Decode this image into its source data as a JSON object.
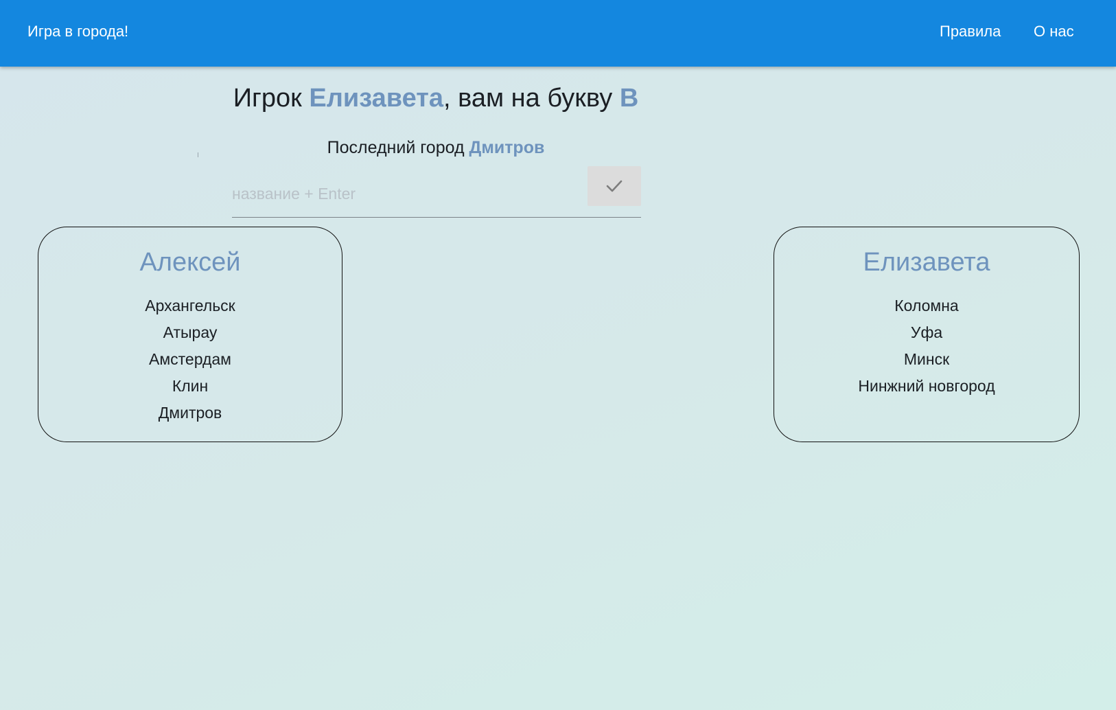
{
  "header": {
    "brand": "Игра в города!",
    "nav": [
      {
        "label": "Правила"
      },
      {
        "label": "О нас"
      }
    ]
  },
  "game": {
    "prompt_prefix": "Игрок ",
    "current_player": "Елизавета",
    "prompt_middle": ", вам на букву ",
    "letter": "В",
    "last_city_label": "Последний город ",
    "last_city": "Дмитров",
    "input_placeholder": "название + Enter",
    "input_value": "",
    "submit_icon": "check-icon"
  },
  "players": [
    {
      "name": "Алексей",
      "cities": [
        "Архангельск",
        "Атырау",
        "Амстердам",
        "Клин",
        "Дмитров"
      ]
    },
    {
      "name": "Елизавета",
      "cities": [
        "Коломна",
        "Уфа",
        "Минск",
        "Нинжний новгород"
      ]
    }
  ],
  "colors": {
    "header_bg": "#1487df",
    "accent": "#6e93bd",
    "button_bg": "#dcdcdc"
  }
}
